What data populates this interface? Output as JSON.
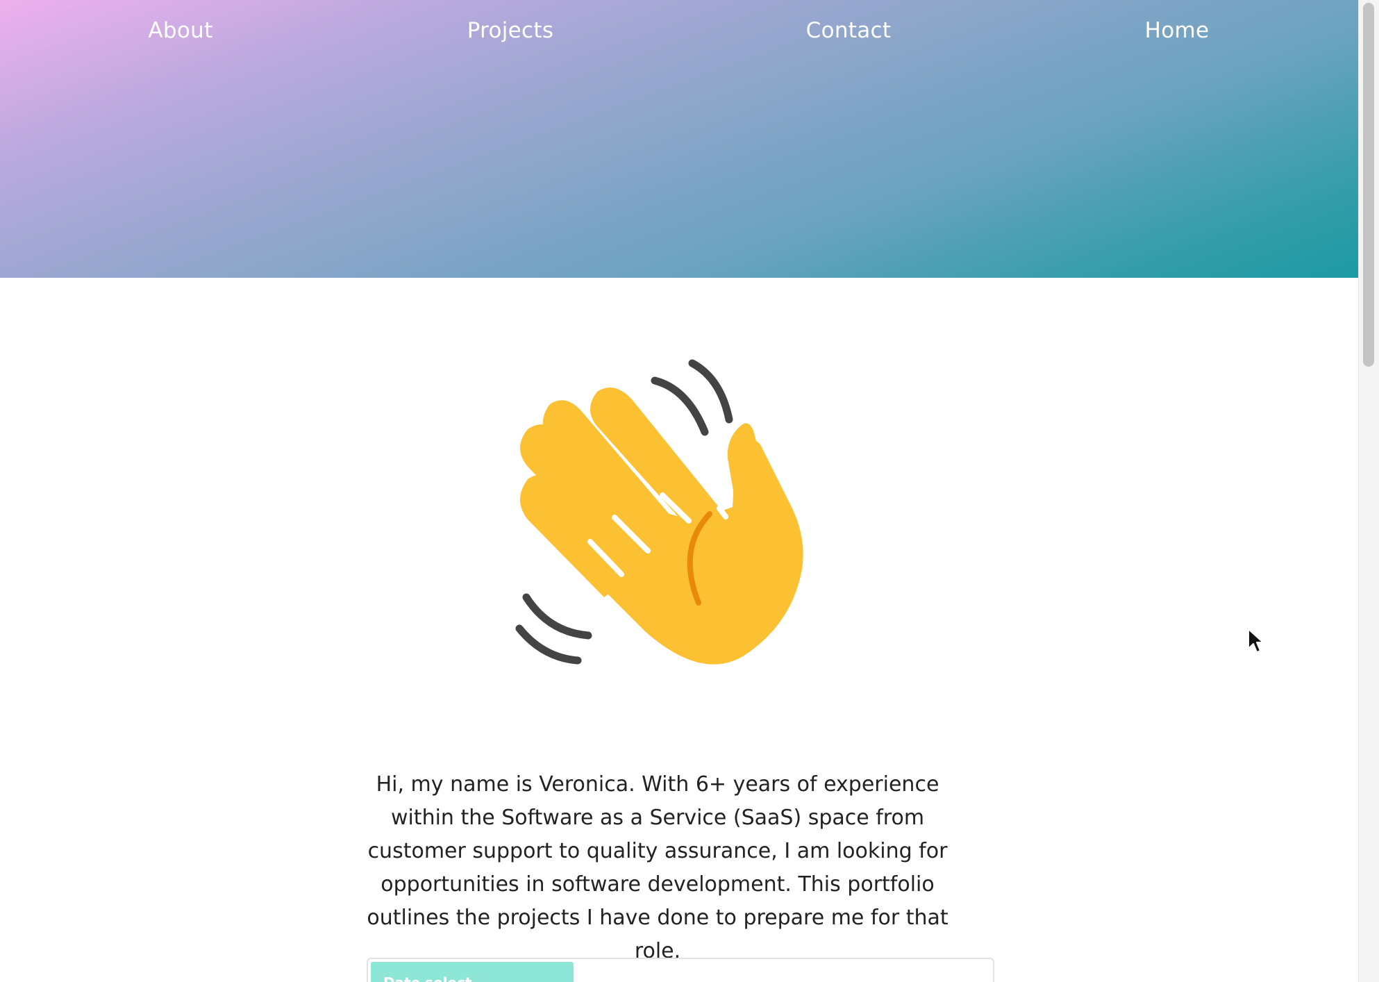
{
  "nav": {
    "items": [
      {
        "label": "About"
      },
      {
        "label": "Projects"
      },
      {
        "label": "Contact"
      },
      {
        "label": "Home"
      }
    ]
  },
  "hero": {
    "icon": "waving-hand-icon",
    "intro_text": "Hi, my name is Veronica. With 6+ years of experience within the Software as a Service (SaaS) space from customer support to quality assurance, I am looking for opportunities in software development. This portfolio outlines the projects I have done to prepare me for that role."
  },
  "project_preview": {
    "tab_label": "Date select"
  },
  "colors": {
    "gradient_start": "#eeb0ee",
    "gradient_end": "#1c9aa3",
    "hand": "#fbc132",
    "hand_line": "#e8890c",
    "motion_lines": "#444444",
    "preview_tab": "#8ee6d6"
  }
}
